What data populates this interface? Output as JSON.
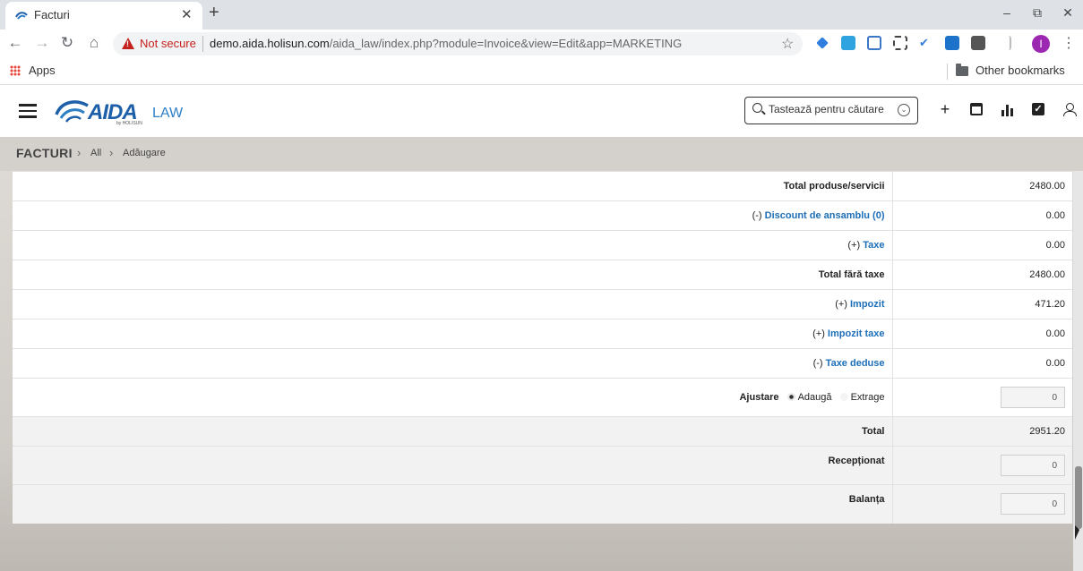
{
  "browser": {
    "tab_title": "Facturi",
    "security_label": "Not secure",
    "url_host": "demo.aida.holisun.com",
    "url_path": "/aida_law/index.php?module=Invoice&view=Edit&app=MARKETING",
    "profile_initial": "I",
    "bookmarks": {
      "apps_label": "Apps",
      "other_label": "Other bookmarks"
    }
  },
  "header": {
    "logo_text": "AIDA",
    "logo_suffix": "LAW",
    "logo_sub": "by HOLISUN",
    "search_placeholder": "Tastează pentru căutare",
    "icons": [
      "plus-icon",
      "calendar-icon",
      "bar-chart-icon",
      "checkbox-icon",
      "user-icon"
    ]
  },
  "breadcrumb": {
    "module": "FACTURI",
    "items": [
      "All",
      "Adăugare"
    ]
  },
  "totals": {
    "total_products_label": "Total produse/servicii",
    "total_products_value": "2480.00",
    "discount_prefix": "(-)",
    "discount_label": "Discount de ansamblu (0)",
    "discount_value": "0.00",
    "taxe_prefix": "(+)",
    "taxe_label": "Taxe",
    "taxe_value": "0.00",
    "total_no_tax_label": "Total fără taxe",
    "total_no_tax_value": "2480.00",
    "impozit_prefix": "(+)",
    "impozit_label": "Impozit",
    "impozit_value": "471.20",
    "impozit_taxe_prefix": "(+)",
    "impozit_taxe_label": "Impozit taxe",
    "impozit_taxe_value": "0.00",
    "taxe_deduse_prefix": "(-)",
    "taxe_deduse_label": "Taxe deduse",
    "taxe_deduse_value": "0.00",
    "ajustare_label": "Ajustare",
    "ajustare_add": "Adaugă",
    "ajustare_subtract": "Extrage",
    "ajustare_selected": "Adaugă",
    "ajustare_value": "0",
    "total_label": "Total",
    "total_value": "2951.20",
    "receptionat_label": "Recepționat",
    "receptionat_value": "0",
    "balanta_label": "Balanța",
    "balanta_value": "0"
  }
}
